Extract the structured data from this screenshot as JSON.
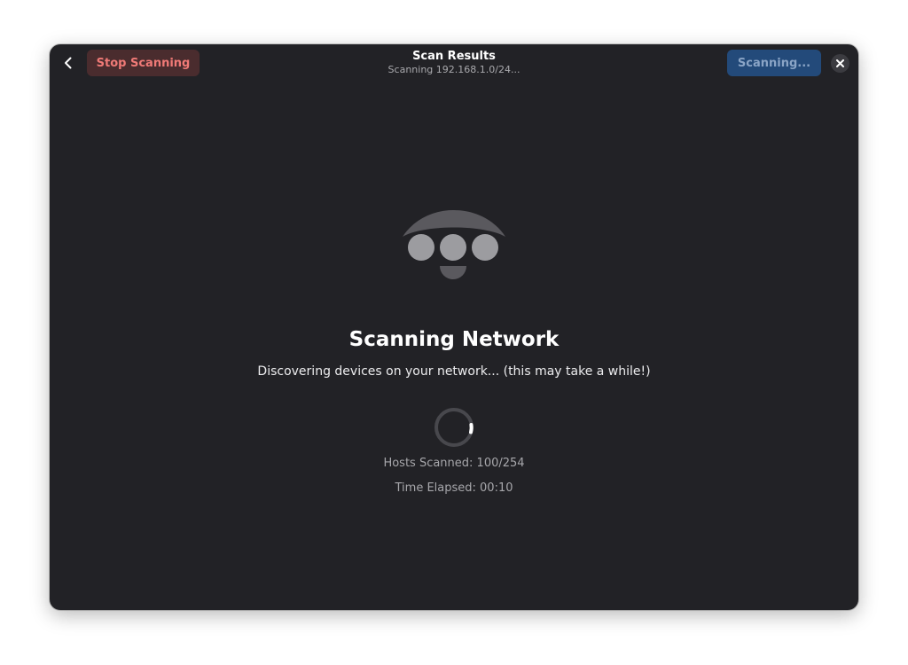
{
  "header": {
    "title": "Scan Results",
    "subtitle": "Scanning 192.168.1.0/24...",
    "stop_label": "Stop Scanning",
    "scanning_label": "Scanning...",
    "back_icon": "chevron-left-icon",
    "close_icon": "close-icon"
  },
  "main": {
    "icon": "network-scan-icon",
    "heading": "Scanning Network",
    "description": "Discovering devices on your network... (this may take a while!)",
    "hosts_scanned": "Hosts Scanned: 100/254",
    "time_elapsed": "Time Elapsed: 00:10",
    "progress_fraction": 0.39
  },
  "colors": {
    "window_bg": "#222226",
    "destructive": "#f07a77",
    "accent": "#234a7a"
  }
}
